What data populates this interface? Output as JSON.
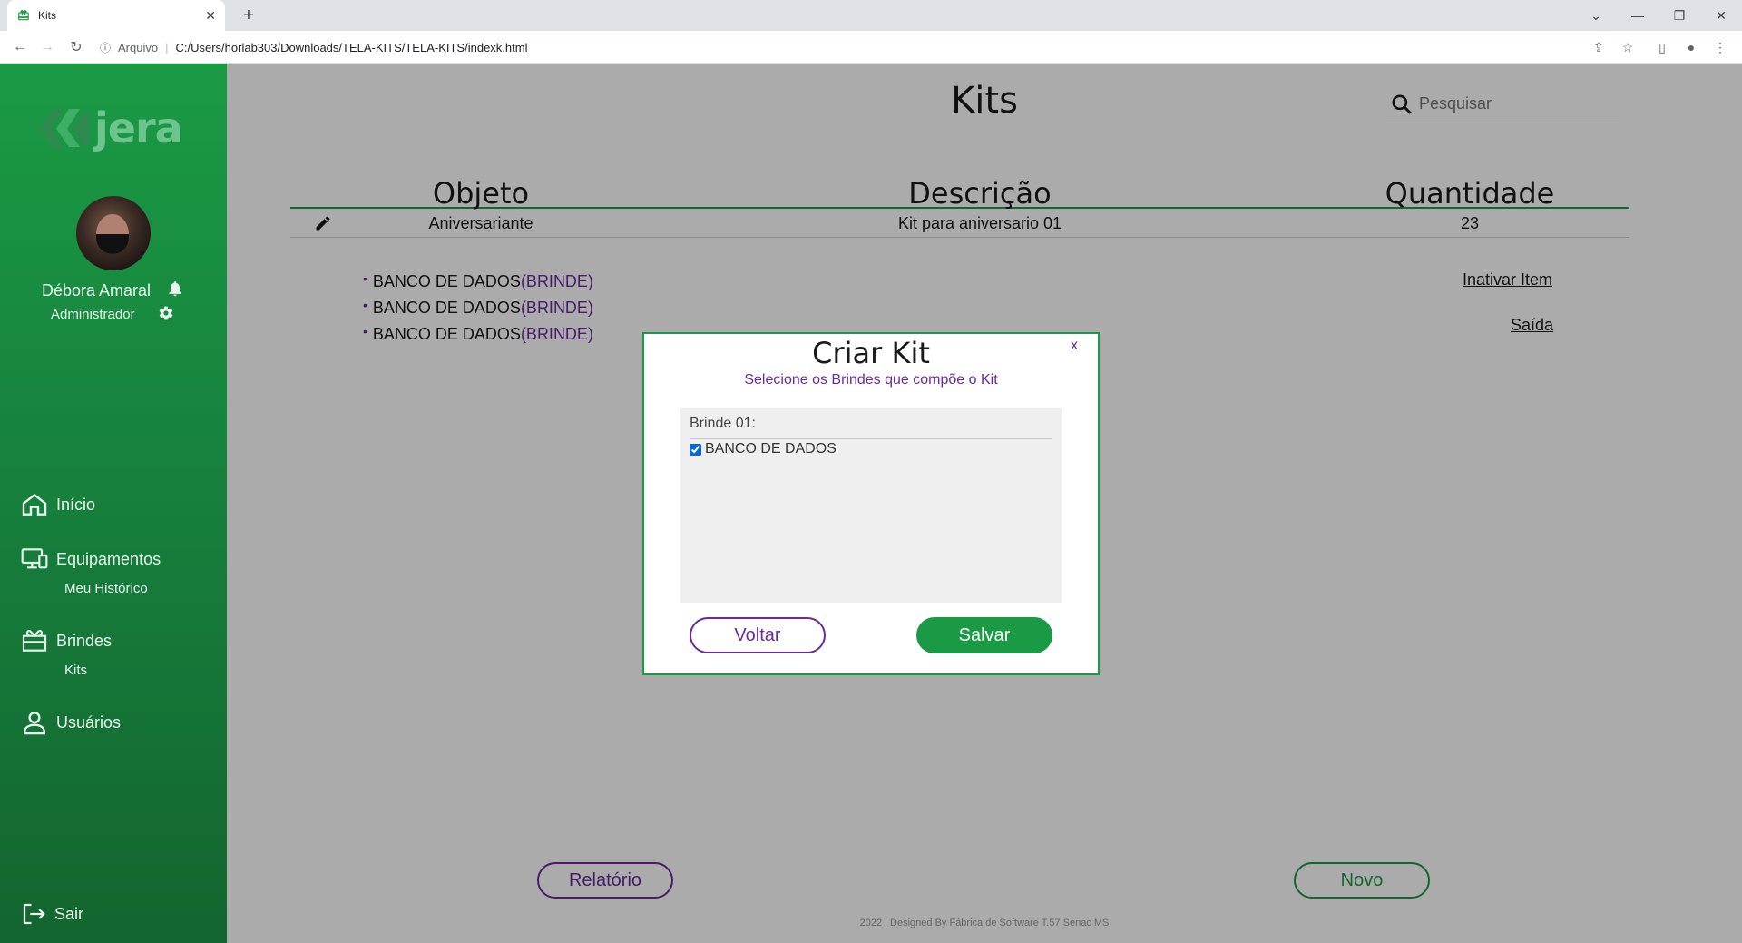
{
  "browser": {
    "tab_title": "Kits",
    "url_scheme_label": "Arquivo",
    "url": "C:/Users/horlab303/Downloads/TELA-KITS/TELA-KITS/indexk.html"
  },
  "sidebar": {
    "brand": "jera",
    "user_name": "Débora Amaral",
    "user_role": "Administrador",
    "nav": {
      "inicio": "Início",
      "equipamentos": "Equipamentos",
      "meu_historico": "Meu Histórico",
      "brindes": "Brindes",
      "kits": "Kits",
      "usuarios": "Usuários",
      "sair": "Sair"
    }
  },
  "header": {
    "title": "Kits",
    "search_placeholder": "Pesquisar"
  },
  "table": {
    "columns": [
      "Objeto",
      "Descrição",
      "Quantidade"
    ],
    "rows": [
      {
        "objeto": "Aniversariante",
        "descricao": "Kit para aniversario 01",
        "quantidade": "23"
      }
    ]
  },
  "kit_items": [
    {
      "name": "BANCO DE DADOS",
      "tag": "(BRINDE)"
    },
    {
      "name": "BANCO DE DADOS",
      "tag": "(BRINDE)"
    },
    {
      "name": "BANCO DE DADOS",
      "tag": "(BRINDE)"
    }
  ],
  "actions": {
    "inativar": "Inativar Item",
    "saida": "Saída",
    "relatorio": "Relatório",
    "novo": "Novo"
  },
  "footer": "2022 | Designed By Fábrica de Software T.57 Senac MS",
  "modal": {
    "title": "Criar Kit",
    "close": "x",
    "subtitle": "Selecione os Brindes que compõe o Kit",
    "list_label": "Brinde 01:",
    "options": [
      {
        "label": "BANCO DE DADOS",
        "checked": true
      }
    ],
    "voltar": "Voltar",
    "salvar": "Salvar"
  },
  "colors": {
    "primary_green": "#1a9a45",
    "accent_purple": "#6a2a9e"
  }
}
